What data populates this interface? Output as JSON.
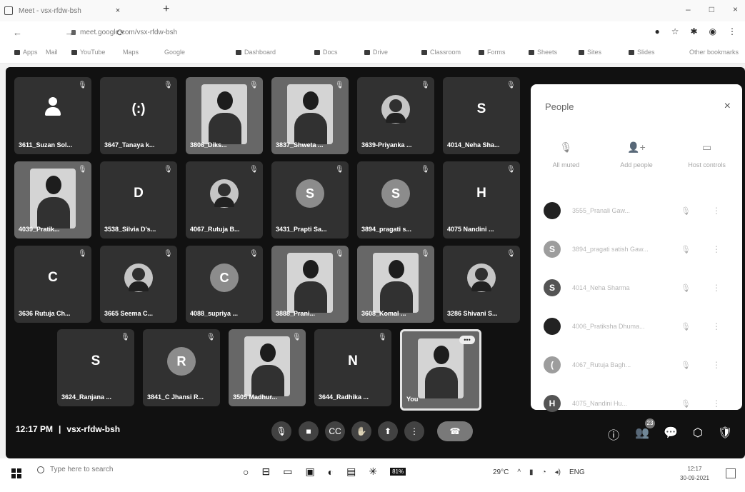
{
  "browser": {
    "tab_title": "Meet - vsx-rfdw-bsh",
    "tab_close": "×",
    "new_tab": "+",
    "url": "meet.google.com/vsx-rfdw-bsh",
    "window_controls": [
      "–",
      "□",
      "×"
    ],
    "nav": "← →  ⟳",
    "bookmarks": [
      "Apps",
      "Mail",
      "YouTube",
      "Maps",
      "Google",
      "Dashboard",
      "Docs",
      "Drive",
      "Classroom",
      "Forms",
      "Sheets",
      "Sites",
      "Slides",
      "Other bookmarks"
    ]
  },
  "tiles": [
    {
      "name": "3611_Suzan Sol...",
      "type": "user-icon"
    },
    {
      "name": "3647_Tanaya k...",
      "type": "avatar-clear",
      "initial": "(:)"
    },
    {
      "name": "3806_Diks...",
      "type": "video"
    },
    {
      "name": "3837_Shweta ...",
      "type": "video"
    },
    {
      "name": "3639-Priyanka ...",
      "type": "avatar-photo"
    },
    {
      "name": "4014_Neha Sha...",
      "type": "avatar-clear",
      "initial": "S"
    },
    {
      "name": "4039_Pratik...",
      "type": "video"
    },
    {
      "name": "3538_Silvia D's...",
      "type": "avatar-clear",
      "initial": "D"
    },
    {
      "name": "4067_Rutuja B...",
      "type": "avatar-photo"
    },
    {
      "name": "3431_Prapti Sa...",
      "type": "avatar-solid",
      "initial": "S"
    },
    {
      "name": "3894_pragati s...",
      "type": "avatar-solid",
      "initial": "S"
    },
    {
      "name": "4075 Nandini ...",
      "type": "avatar-clear",
      "initial": "H"
    },
    {
      "name": "3636 Rutuja Ch...",
      "type": "avatar-clear",
      "initial": "C"
    },
    {
      "name": "3665 Seema C...",
      "type": "avatar-photo"
    },
    {
      "name": "4088_supriya ...",
      "type": "avatar-solid",
      "initial": "C"
    },
    {
      "name": "3888_Prani...",
      "type": "video"
    },
    {
      "name": "3608_Komal ...",
      "type": "video"
    },
    {
      "name": "3286 Shivani S...",
      "type": "avatar-photo"
    },
    {
      "name": "3624_Ranjana ...",
      "type": "avatar-clear",
      "initial": "S"
    },
    {
      "name": "3841_C Jhansi R...",
      "type": "avatar-solid",
      "initial": "R"
    },
    {
      "name": "3505 Madhur...",
      "type": "video"
    },
    {
      "name": "3644_Radhika ...",
      "type": "avatar-clear",
      "initial": "N"
    },
    {
      "name": "You",
      "type": "you"
    }
  ],
  "people_panel": {
    "title": "People",
    "close": "×",
    "actions": [
      {
        "label": "All muted",
        "icon": "mic-off-icon",
        "glyph": "🎙"
      },
      {
        "label": "Add people",
        "icon": "add-person-icon",
        "glyph": "👤+"
      },
      {
        "label": "Host controls",
        "icon": "host-controls-icon",
        "glyph": "▭"
      }
    ],
    "participants": [
      {
        "name": "3555_Pranali Gaw...",
        "initial": "",
        "avatar": "pic"
      },
      {
        "name": "3894_pragati satish Gaw...",
        "initial": "S",
        "avatar": "light"
      },
      {
        "name": "4014_Neha Sharma",
        "initial": "S",
        "avatar": "solid"
      },
      {
        "name": "4006_Pratiksha Dhuma...",
        "initial": "",
        "avatar": "pic"
      },
      {
        "name": "4067_Rutuja Bagh...",
        "initial": "(",
        "avatar": "light"
      },
      {
        "name": "4075_Nandini Hu...",
        "initial": "H",
        "avatar": "solid"
      }
    ]
  },
  "meeting": {
    "time": "12:17 PM",
    "separator": "|",
    "code": "vsx-rfdw-bsh",
    "controls": [
      "🎙",
      "■",
      "CC",
      "✋",
      "⬆",
      "⋮",
      "☎"
    ],
    "right_controls": [
      "ⓘ",
      "👥",
      "💬",
      "⬡",
      "🛡"
    ],
    "participants_badge": "23"
  },
  "taskbar": {
    "search_placeholder": "Type here to search",
    "battery": "81%",
    "temperature": "29°C",
    "language": "ENG",
    "time": "12:17",
    "date": "30-09-2021"
  }
}
